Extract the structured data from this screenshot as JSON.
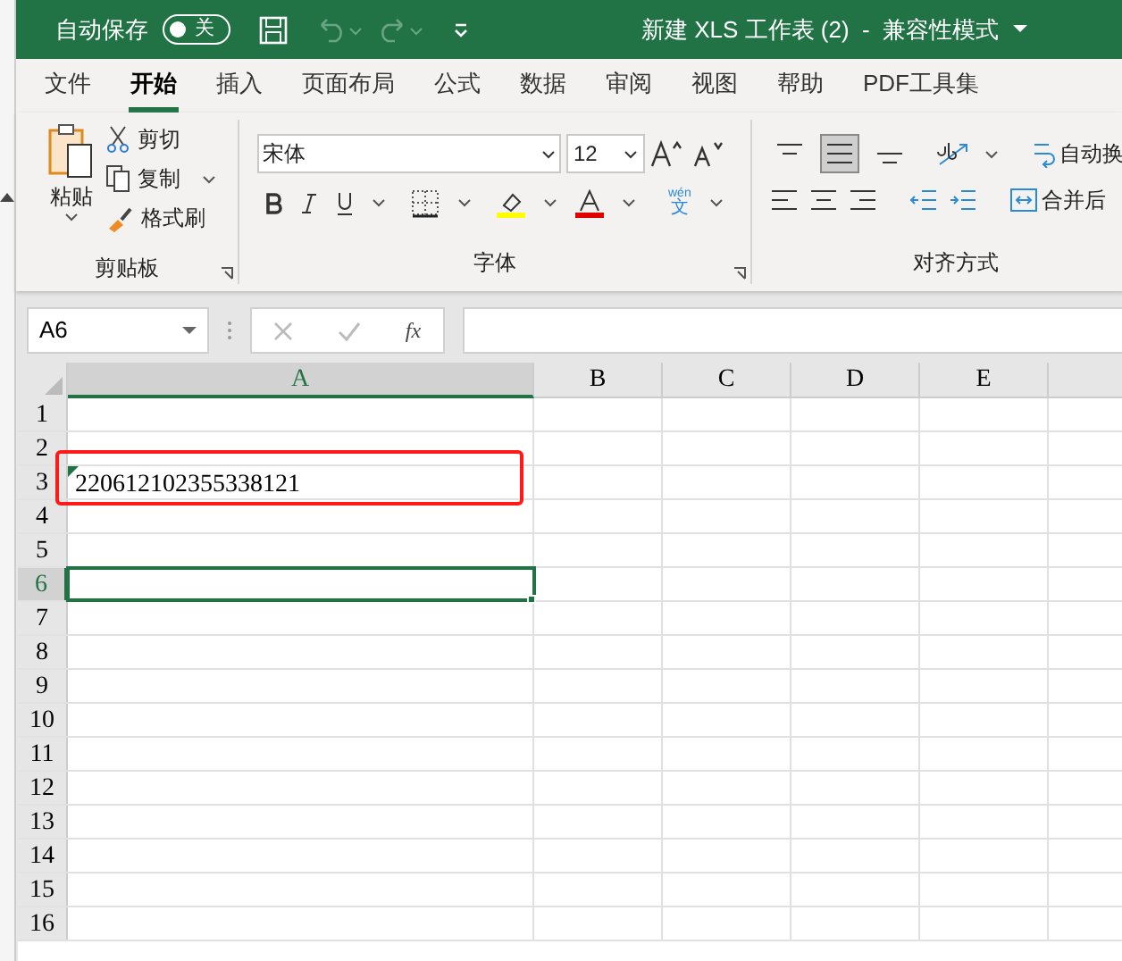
{
  "title_bar": {
    "autosave_label": "自动保存",
    "autosave_toggle": {
      "on": false,
      "text": "关"
    },
    "title": "新建 XLS 工作表 (2)  -  兼容性模式"
  },
  "tabs": [
    {
      "label": "文件",
      "selected": false
    },
    {
      "label": "开始",
      "selected": true
    },
    {
      "label": "插入",
      "selected": false
    },
    {
      "label": "页面布局",
      "selected": false
    },
    {
      "label": "公式",
      "selected": false
    },
    {
      "label": "数据",
      "selected": false
    },
    {
      "label": "审阅",
      "selected": false
    },
    {
      "label": "视图",
      "selected": false
    },
    {
      "label": "帮助",
      "selected": false
    },
    {
      "label": "PDF工具集",
      "selected": false
    }
  ],
  "ribbon": {
    "clipboard": {
      "paste": "粘贴",
      "cut": "剪切",
      "copy": "复制",
      "format_painter": "格式刷",
      "label": "剪贴板"
    },
    "font": {
      "font_name": "宋体",
      "font_size": "12",
      "phonetic_top": "wén",
      "phonetic_bottom": "文",
      "label": "字体"
    },
    "alignment": {
      "vertical": [
        {
          "kind": "top",
          "selected": false
        },
        {
          "kind": "middle",
          "selected": true
        },
        {
          "kind": "bottom",
          "selected": false
        }
      ],
      "wrap_text": "自动换",
      "merge": "合并后",
      "label": "对齐方式"
    }
  },
  "formula_bar": {
    "name_box": "A6",
    "fx": "fx"
  },
  "sheet": {
    "columns": [
      {
        "label": "A",
        "selected": true
      },
      {
        "label": "B",
        "selected": false
      },
      {
        "label": "C",
        "selected": false
      },
      {
        "label": "D",
        "selected": false
      },
      {
        "label": "E",
        "selected": false
      }
    ],
    "rows": [
      {
        "label": "1",
        "selected": false
      },
      {
        "label": "2",
        "selected": false
      },
      {
        "label": "3",
        "selected": false,
        "cell_a": "220612102355338121",
        "highlighted": true
      },
      {
        "label": "4",
        "selected": false
      },
      {
        "label": "5",
        "selected": false
      },
      {
        "label": "6",
        "selected": true
      },
      {
        "label": "7",
        "selected": false
      },
      {
        "label": "8",
        "selected": false
      },
      {
        "label": "9",
        "selected": false
      },
      {
        "label": "10",
        "selected": false
      },
      {
        "label": "11",
        "selected": false
      },
      {
        "label": "12",
        "selected": false
      },
      {
        "label": "13",
        "selected": false
      },
      {
        "label": "14",
        "selected": false
      },
      {
        "label": "15",
        "selected": false
      },
      {
        "label": "16",
        "selected": false
      }
    ]
  }
}
